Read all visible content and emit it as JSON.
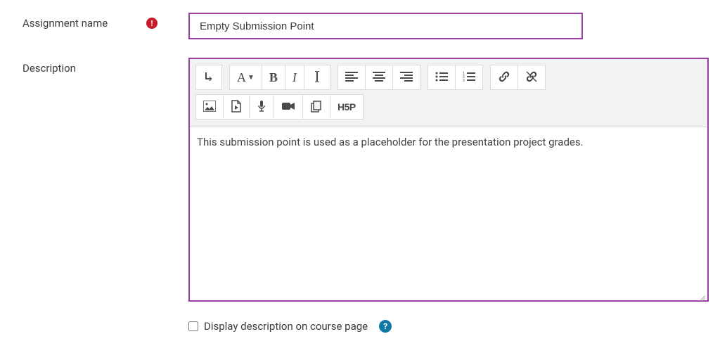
{
  "assignmentName": {
    "label": "Assignment name",
    "value": "Empty Submission Point"
  },
  "description": {
    "label": "Description",
    "value": "This submission point is used as a placeholder for the presentation project grades."
  },
  "displayOnCoursePage": {
    "label": "Display description on course page",
    "checked": false
  },
  "h5p_label": "H5P"
}
